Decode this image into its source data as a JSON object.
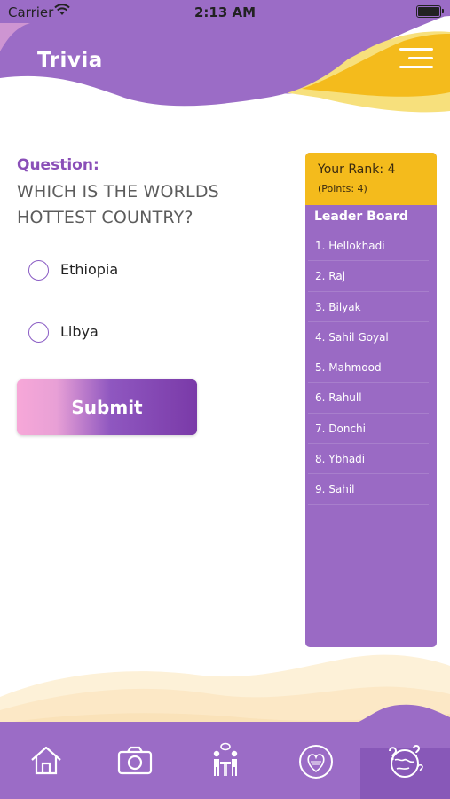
{
  "status_bar": {
    "carrier": "Carrier",
    "time": "2:13 AM"
  },
  "header": {
    "title": "Trivia",
    "menu_icon": "hamburger-menu-icon"
  },
  "question": {
    "label": "Question:",
    "text": "WHICH IS THE WORLDS HOTTEST COUNTRY?",
    "options": [
      "Ethiopia",
      "Libya"
    ],
    "submit_label": "Submit"
  },
  "leaderboard": {
    "rank_label": "Your Rank: 4",
    "points_label": "(Points: 4)",
    "title": "Leader Board",
    "entries": [
      "1. Hellokhadi",
      "2. Raj",
      "3. Bilyak",
      "4. Sahil Goyal",
      "5. Mahmood",
      "6. Rahull",
      "7. Donchi",
      "8. Ybhadi",
      "9. Sahil"
    ]
  },
  "tabbar": {
    "tabs": [
      "home-icon",
      "camera-icon",
      "people-chat-icon",
      "love-tattoo-badge-icon",
      "trivia-question-globe-icon"
    ],
    "active_index": 4
  },
  "colors": {
    "purple": "#9b6cc6",
    "accent_yellow": "#f4bb1c",
    "question_label": "#8a4fb8"
  }
}
